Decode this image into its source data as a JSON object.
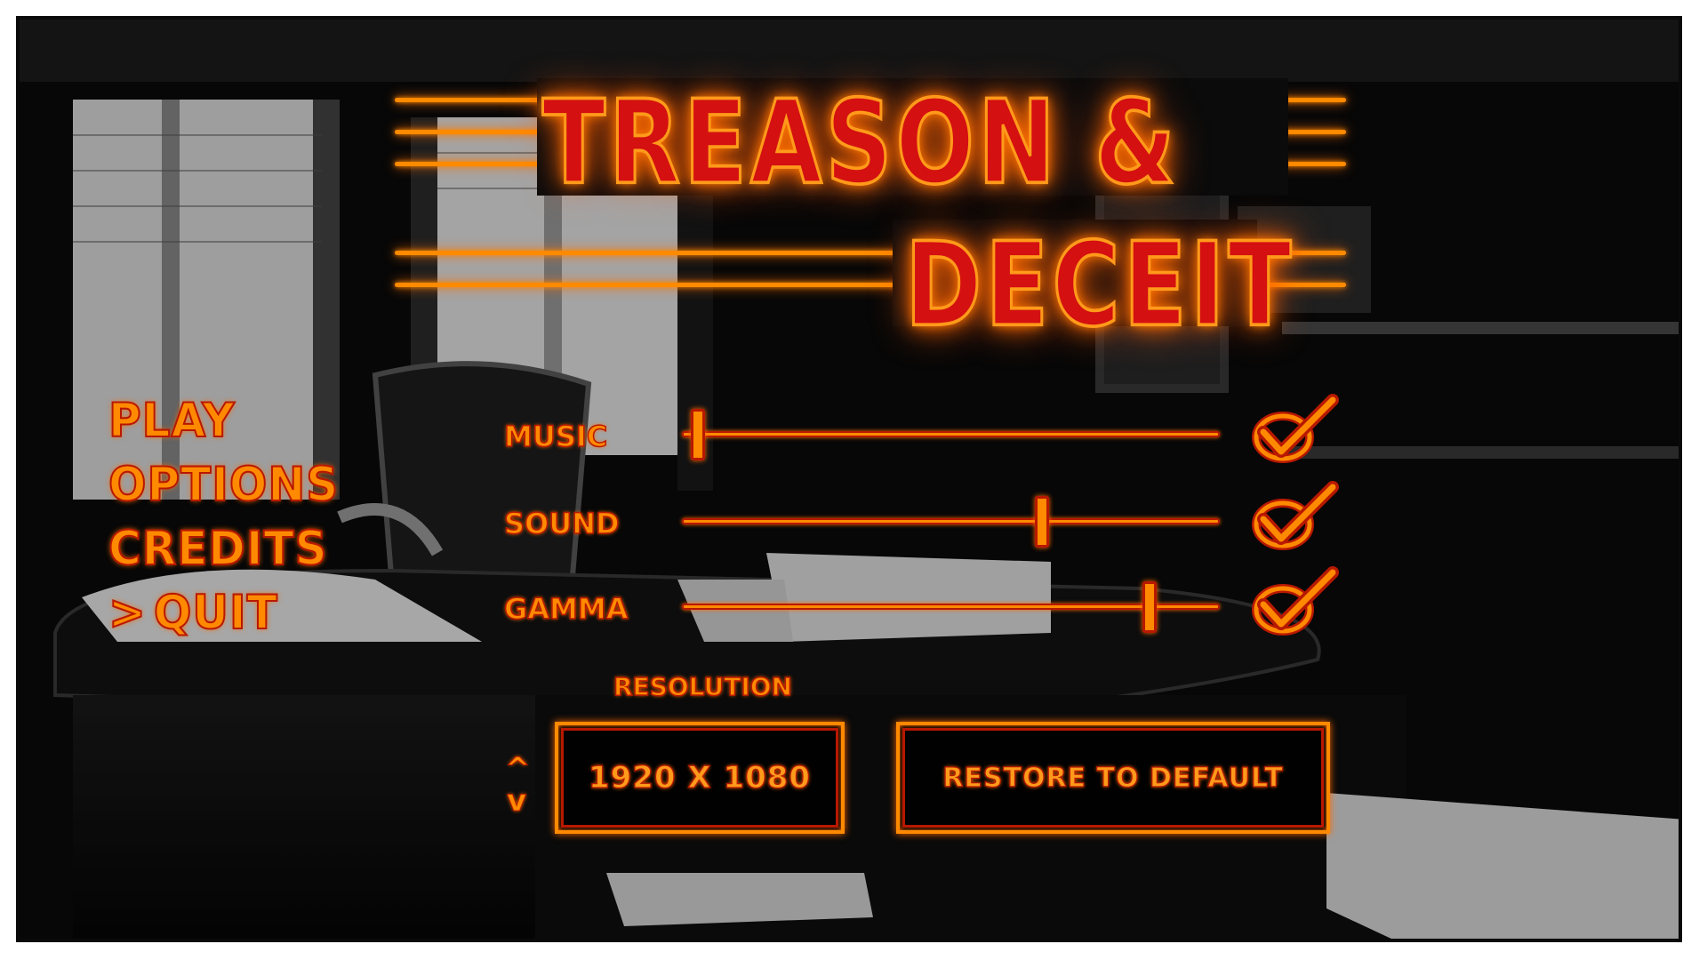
{
  "title": {
    "line1": "TREASON &",
    "line2": "DECEIT"
  },
  "menu": {
    "items": [
      {
        "label": "PLAY"
      },
      {
        "label": "OPTIONS"
      },
      {
        "label": "CREDITS"
      },
      {
        "label": "QUIT",
        "selected": true,
        "cursor": ">"
      }
    ]
  },
  "options": {
    "music": {
      "label": "MUSIC",
      "level": 0.03,
      "enabled": true
    },
    "sound": {
      "label": "SOUND",
      "level": 0.67,
      "enabled": true
    },
    "gamma": {
      "label": "GAMMA",
      "level": 0.87,
      "enabled": true
    }
  },
  "resolution": {
    "label": "RESOLUTION",
    "value": "1920 X 1080",
    "up_icon": "^",
    "down_icon": "v"
  },
  "restore_button": {
    "label": "RESTORE TO DEFAULT"
  },
  "colors": {
    "neon_orange": "#ff8a00",
    "neon_red": "#d41010",
    "outline_red": "#b81800",
    "background": "#090909"
  }
}
